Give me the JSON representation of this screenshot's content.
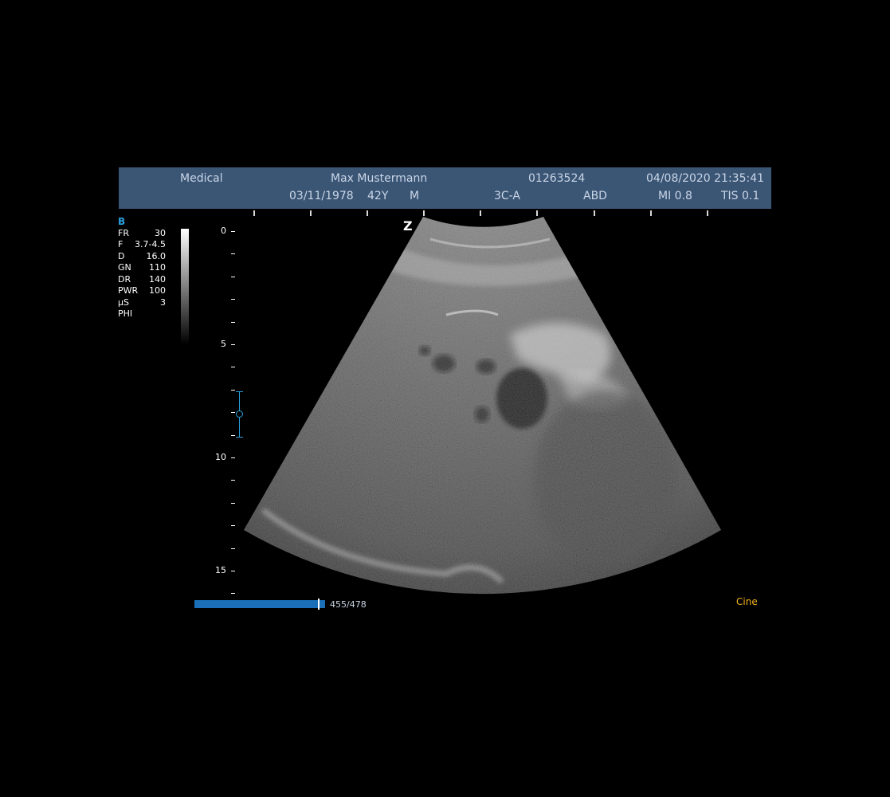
{
  "header": {
    "institution": "Medical",
    "patient_name": "Max Mustermann",
    "patient_id": "01263524",
    "datetime": "04/08/2020 21:35:41",
    "dob": "03/11/1978",
    "age": "42Y",
    "sex": "M",
    "probe": "3C-A",
    "preset": "ABD",
    "mi": "MI 0.8",
    "tis": "TIS 0.1"
  },
  "imaging": {
    "mode": "B",
    "params": [
      {
        "key": "FR",
        "value": "30"
      },
      {
        "key": "F",
        "value": "3.7-4.5"
      },
      {
        "key": "D",
        "value": "16.0"
      },
      {
        "key": "GN",
        "value": "110"
      },
      {
        "key": "DR",
        "value": "140"
      },
      {
        "key": "PWR",
        "value": "100"
      },
      {
        "key": "µS",
        "value": "3"
      },
      {
        "key": "PHI",
        "value": ""
      }
    ],
    "orientation_marker": "Z"
  },
  "depth_scale": {
    "labels": [
      "0",
      "5",
      "10",
      "15"
    ],
    "max_depth_cm": 16
  },
  "cine": {
    "frame_count": "455/478",
    "progress": 0.95,
    "label": "Cine"
  },
  "colors": {
    "header_bg": "#3b5575",
    "accent": "#2aa0de",
    "cine_label": "#f3b21c"
  }
}
